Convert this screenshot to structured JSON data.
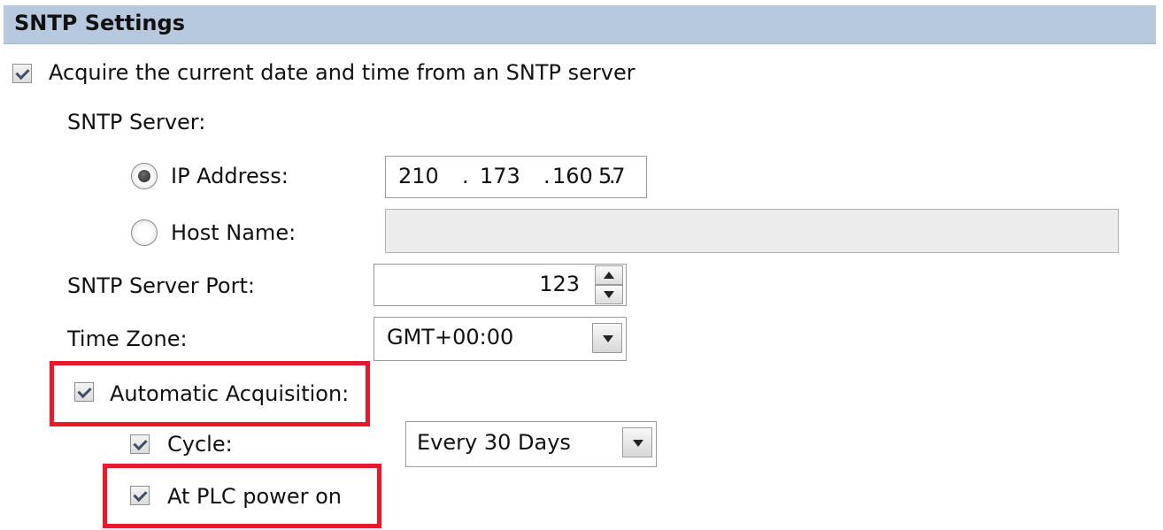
{
  "header": {
    "title": "SNTP Settings"
  },
  "acquire": {
    "label": "Acquire the current date and time from an SNTP server",
    "checked": true
  },
  "server": {
    "section_label": "SNTP Server:",
    "ip_option_label": "IP Address:",
    "ip_octets": [
      "210",
      ".",
      "173",
      ".",
      "160",
      ".",
      "57"
    ],
    "host_option_label": "Host Name:",
    "host_value": "",
    "selected": "ip"
  },
  "port": {
    "label": "SNTP Server Port:",
    "value": "123"
  },
  "timezone": {
    "label": "Time Zone:",
    "value": "GMT+00:00"
  },
  "auto": {
    "label": "Automatic Acquisition:",
    "checked": true,
    "cycle_label": "Cycle:",
    "cycle_checked": true,
    "cycle_value": "Every 30 Days",
    "power_on_label": "At PLC power on",
    "power_on_checked": true
  },
  "colors": {
    "header_bg": "#b7c9df",
    "highlight": "#e8192c"
  }
}
